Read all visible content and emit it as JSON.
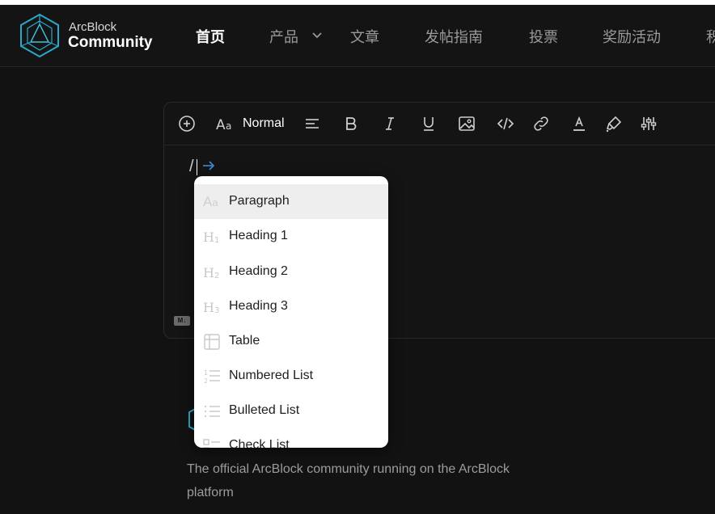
{
  "brand": {
    "top": "ArcBlock",
    "bottom": "Community"
  },
  "nav": {
    "items": [
      "首页",
      "产品",
      "文章",
      "发帖指南",
      "投票",
      "奖励活动",
      "积"
    ],
    "active_index": 0,
    "dropdown_item_index": 1
  },
  "toolbar": {
    "text_style": "Normal",
    "icons": [
      "add-circle-icon",
      "font-style-icon",
      "align-icon",
      "bold-icon",
      "italic-icon",
      "underline-icon",
      "image-icon",
      "code-icon",
      "link-icon",
      "text-color-icon",
      "highlight-icon",
      "settings-sliders-icon"
    ]
  },
  "editor": {
    "typed_text": "/",
    "markdown_badge": "M↓"
  },
  "slash_menu": {
    "selected_index": 0,
    "items": [
      {
        "label": "Paragraph",
        "icon": "paragraph-icon"
      },
      {
        "label": "Heading 1",
        "icon": "heading-1-icon"
      },
      {
        "label": "Heading 2",
        "icon": "heading-2-icon"
      },
      {
        "label": "Heading 3",
        "icon": "heading-3-icon"
      },
      {
        "label": "Table",
        "icon": "table-icon"
      },
      {
        "label": "Numbered List",
        "icon": "numbered-list-icon"
      },
      {
        "label": "Bulleted List",
        "icon": "bulleted-list-icon"
      },
      {
        "label": "Check List",
        "icon": "check-list-icon"
      }
    ]
  },
  "community": {
    "description": "The official ArcBlock community running on the ArcBlock platform"
  },
  "colors": {
    "background": "#121212",
    "accent": "#3ab0d8",
    "menu_bg": "#ffffff",
    "menu_selected": "#eeeeee"
  }
}
